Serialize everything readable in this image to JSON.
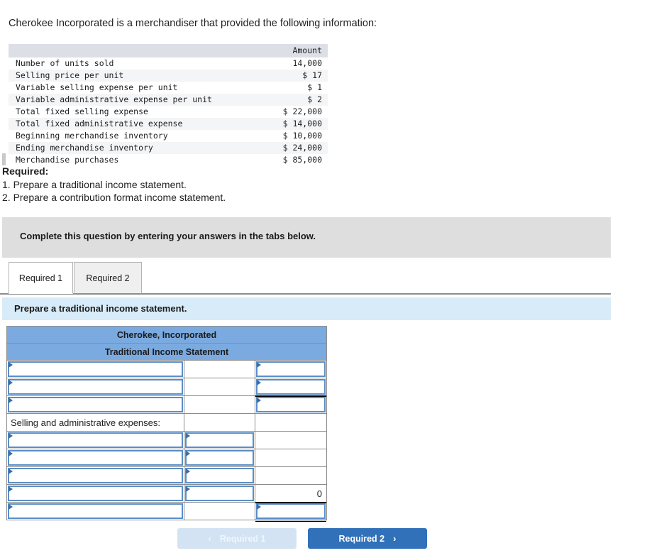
{
  "intro": "Cherokee Incorporated is a merchandiser that provided the following information:",
  "facts_table": {
    "columns": [
      "",
      "Amount"
    ],
    "rows": [
      {
        "label": "Number of units sold",
        "amount": "14,000"
      },
      {
        "label": "Selling price per unit",
        "amount": "$ 17"
      },
      {
        "label": "Variable selling expense per unit",
        "amount": "$ 1"
      },
      {
        "label": "Variable administrative expense per unit",
        "amount": "$ 2"
      },
      {
        "label": "Total fixed selling expense",
        "amount": "$ 22,000"
      },
      {
        "label": "Total fixed administrative expense",
        "amount": "$ 14,000"
      },
      {
        "label": "Beginning merchandise inventory",
        "amount": "$ 10,000"
      },
      {
        "label": "Ending merchandise inventory",
        "amount": "$ 24,000"
      },
      {
        "label": "Merchandise purchases",
        "amount": "$ 85,000"
      }
    ]
  },
  "required": {
    "heading": "Required:",
    "items": [
      "1. Prepare a traditional income statement.",
      "2. Prepare a contribution format income statement."
    ]
  },
  "banner": {
    "text": "Complete this question by entering your answers in the tabs below."
  },
  "tabs": [
    {
      "label": "Required 1",
      "active": true
    },
    {
      "label": "Required 2",
      "active": false
    }
  ],
  "sub_instruction": "Prepare a traditional income statement.",
  "statement": {
    "title_line_1": "Cherokee, Incorporated",
    "title_line_2": "Traditional Income Statement",
    "rows": [
      {
        "col1": "",
        "col1_type": "edit",
        "col2": "",
        "col2_type": "plain",
        "col3": "",
        "col3_type": "edit"
      },
      {
        "col1": "",
        "col1_type": "edit",
        "col2": "",
        "col2_type": "plain",
        "col3": "",
        "col3_type": "edit"
      },
      {
        "col1": "",
        "col1_type": "edit",
        "col2": "",
        "col2_type": "plain",
        "col3": "",
        "col3_type": "edit-rule-top"
      },
      {
        "col1": "Selling and administrative expenses:",
        "col1_type": "label",
        "col2": "",
        "col2_type": "plain",
        "col3": "",
        "col3_type": "plain"
      },
      {
        "col1": "",
        "col1_type": "edit",
        "col2": "",
        "col2_type": "edit",
        "col3": "",
        "col3_type": "plain"
      },
      {
        "col1": "",
        "col1_type": "edit",
        "col2": "",
        "col2_type": "edit",
        "col3": "",
        "col3_type": "plain"
      },
      {
        "col1": "",
        "col1_type": "edit",
        "col2": "",
        "col2_type": "edit",
        "col3": "",
        "col3_type": "plain"
      },
      {
        "col1": "",
        "col1_type": "edit",
        "col2": "",
        "col2_type": "edit",
        "col3": "0",
        "col3_type": "num"
      },
      {
        "col1": "",
        "col1_type": "edit",
        "col2": "",
        "col2_type": "plain",
        "col3": "",
        "col3_type": "edit-total"
      }
    ]
  },
  "nav": {
    "prev_label": "Required 1",
    "prev_chevron": "‹",
    "next_label": "Required 2",
    "next_chevron": "›"
  },
  "colors": {
    "header_blue": "#7aaae0",
    "sub_instruction_blue": "#d8ebf8",
    "banner_grey": "#dedede",
    "edit_border": "#5b8fc9",
    "next_button": "#3071b9",
    "prev_button": "#d3e3f3"
  }
}
